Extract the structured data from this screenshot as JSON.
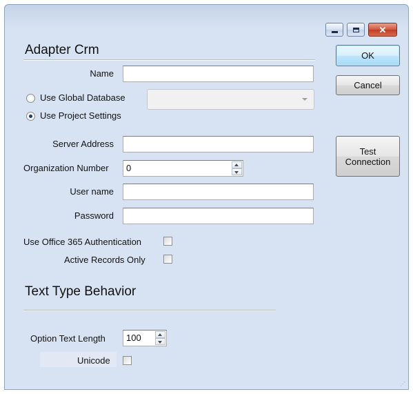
{
  "titlebar": {
    "minimize_icon": "minimize-icon",
    "maximize_icon": "maximize-icon",
    "close_icon": "close-icon",
    "close_glyph": "✕"
  },
  "adapter": {
    "heading": "Adapter Crm",
    "name_label": "Name",
    "name_value": "",
    "use_global_db_label": "Use Global Database",
    "use_global_db_checked": false,
    "global_db_value": "",
    "use_project_settings_label": "Use Project Settings",
    "use_project_settings_checked": true,
    "server_address_label": "Server Address",
    "server_address_value": "",
    "org_number_label": "Organization Number",
    "org_number_value": "0",
    "user_name_label": "User name",
    "user_name_value": "",
    "password_label": "Password",
    "password_value": "",
    "office365_label": "Use Office 365 Authentication",
    "office365_checked": false,
    "active_records_label": "Active Records Only",
    "active_records_checked": false
  },
  "text_type": {
    "heading": "Text Type Behavior",
    "option_text_length_label": "Option Text Length",
    "option_text_length_value": "100",
    "unicode_label": "Unicode",
    "unicode_checked": false
  },
  "buttons": {
    "ok": "OK",
    "cancel": "Cancel",
    "test_connection": "Test\nConnection"
  },
  "colors": {
    "accent_blue": "#3c7fb1",
    "close_red": "#c13c25"
  }
}
